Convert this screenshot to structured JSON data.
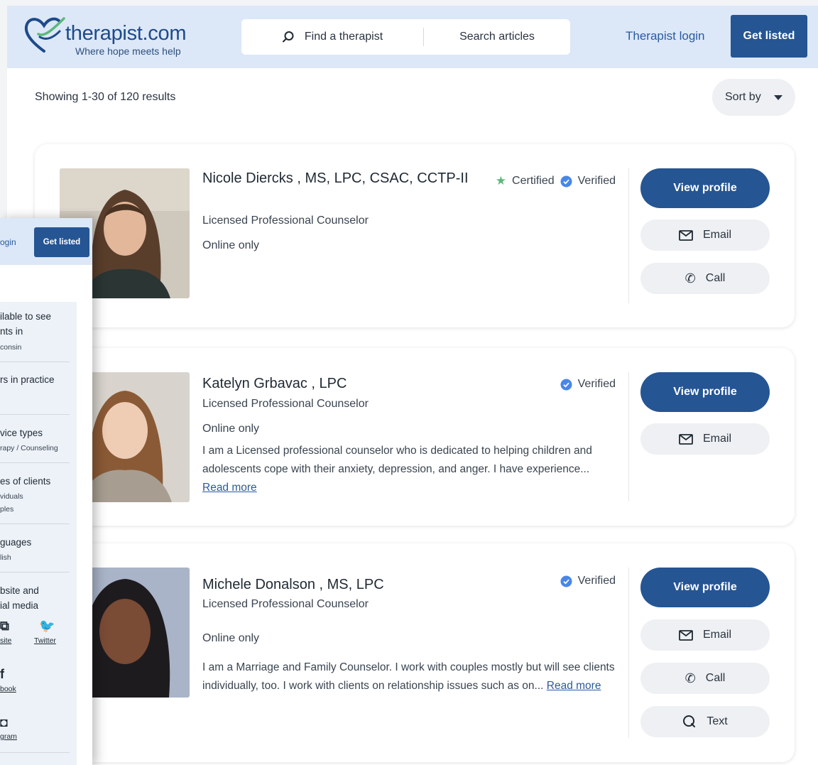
{
  "header": {
    "logo_word": "therapist.com",
    "logo_tagline": "Where hope meets help",
    "search_find": "Find a therapist",
    "search_articles": "Search articles",
    "therapist_login": "Therapist login",
    "get_listed": "Get listed"
  },
  "results": {
    "summary": "Showing 1-30 of 120 results",
    "sort_label": "Sort by"
  },
  "therapists": [
    {
      "name": "Nicole Diercks , MS, LPC, CSAC, CCTP-II",
      "title": "Licensed Professional Counselor",
      "availability": "Online only",
      "certified": "Certified",
      "verified": "Verified",
      "bio": "",
      "read_more": "",
      "buttons": {
        "view": "View profile",
        "email": "Email",
        "call": "Call"
      }
    },
    {
      "name": "Katelyn Grbavac , LPC",
      "title": "Licensed Professional Counselor",
      "availability": "Online only",
      "verified": "Verified",
      "bio": "I am a Licensed professional counselor who is dedicated to helping children and adolescents cope with their anxiety, depression, and anger. I have experience...",
      "read_more": "Read more",
      "buttons": {
        "view": "View profile",
        "email": "Email"
      }
    },
    {
      "name": "Michele Donalson , MS, LPC",
      "title": "Licensed Professional Counselor",
      "availability": "Online only",
      "verified": "Verified",
      "bio": "I am a Marriage and Family Counselor. I work with couples mostly but will see clients individually, too. I work with clients on relationship issues such as on...",
      "read_more": "Read more",
      "buttons": {
        "view": "View profile",
        "email": "Email",
        "call": "Call",
        "text": "Text"
      }
    }
  ],
  "overlay": {
    "login": "ogin",
    "get_listed": "Get listed",
    "available_heading": "ilable to see",
    "available_heading2": "nts in",
    "available_value": "consin",
    "years_heading": "rs in practice",
    "service_heading": "vice types",
    "service_value": "rapy / Counseling",
    "clients_heading": "es of clients",
    "clients_value1": "viduals",
    "clients_value2": "ples",
    "languages_heading": "guages",
    "languages_value": "lish",
    "website_heading": "bsite and",
    "website_heading2": "ial media",
    "website_link": "site",
    "twitter_link": "Twitter",
    "facebook_link": "book",
    "instagram_link": "gram"
  },
  "colors": {
    "brand_blue": "#255593",
    "header_bg": "#dce8f8",
    "verified_blue": "#4a86e8",
    "certified_green": "#5cb87a"
  }
}
